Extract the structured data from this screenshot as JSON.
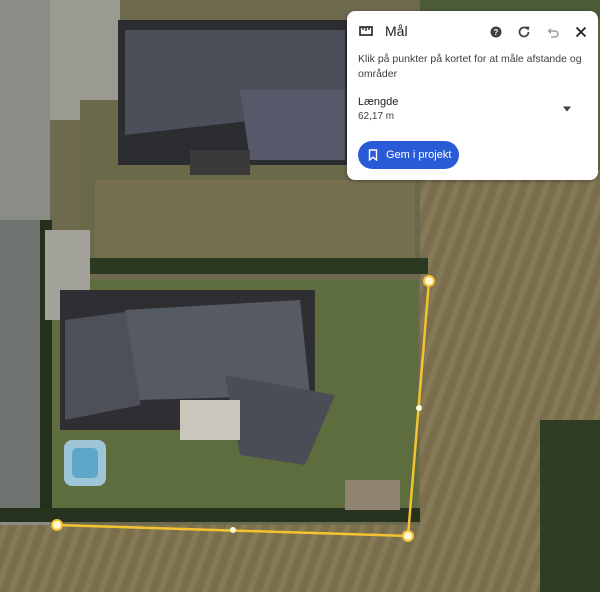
{
  "map": {
    "measure_line_color": "#f4c430",
    "view": "satellite"
  },
  "panel": {
    "title": "Mål",
    "title_icon": "ruler-icon",
    "instructions": "Klik på punkter på kortet for at måle afstande og områder",
    "length_label": "Længde",
    "length_value": "62,17 m",
    "save_label": "Gem i projekt",
    "save_icon": "bookmark-icon",
    "header_icons": [
      "help-icon",
      "reset-icon",
      "undo-icon",
      "close-icon"
    ],
    "accent": "#2a5bd7"
  }
}
